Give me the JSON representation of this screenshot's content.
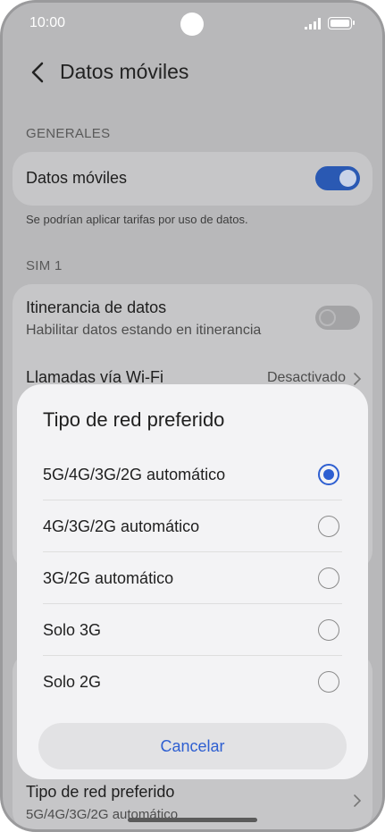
{
  "status_bar": {
    "time": "10:00"
  },
  "header": {
    "title": "Datos móviles"
  },
  "general": {
    "section_label": "GENERALES",
    "mobile_data": {
      "label": "Datos móviles",
      "enabled": true
    },
    "hint": "Se podrían aplicar tarifas por uso de datos."
  },
  "sim1": {
    "section_label": "SIM 1",
    "roaming": {
      "title": "Itinerancia de datos",
      "subtitle": "Habilitar datos estando en itinerancia",
      "enabled": false
    },
    "wifi_calls": {
      "title": "Llamadas vía Wi-Fi",
      "value": "Desactivado"
    }
  },
  "background_row": {
    "title": "Tipo de red preferido",
    "value": "5G/4G/3G/2G automático"
  },
  "dialog": {
    "title": "Tipo de red preferido",
    "options": [
      {
        "label": "5G/4G/3G/2G automático",
        "selected": true
      },
      {
        "label": "4G/3G/2G automático",
        "selected": false
      },
      {
        "label": "3G/2G automático",
        "selected": false
      },
      {
        "label": "Solo 3G",
        "selected": false
      },
      {
        "label": "Solo 2G",
        "selected": false
      }
    ],
    "cancel_label": "Cancelar"
  },
  "colors": {
    "accent": "#2e5fd1",
    "toggle_on": "#2a59b3",
    "dim_background": "#b8b8ba"
  }
}
